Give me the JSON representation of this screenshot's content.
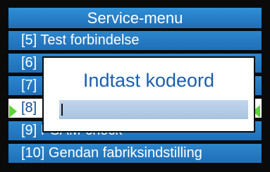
{
  "header": {
    "title": "Service-menu"
  },
  "menu": {
    "items": [
      {
        "label": "[5] Test forbindelse"
      },
      {
        "label": "[6]"
      },
      {
        "label": "[7]"
      },
      {
        "label": "[8]"
      },
      {
        "label": "[9] PSAM-check"
      },
      {
        "label": "[10] Gendan fabriksindstilling"
      }
    ],
    "selected_index": 3
  },
  "dialog": {
    "title": "Indtast kodeord",
    "input_value": ""
  },
  "icons": {
    "left_indicator": "triangle-right-icon",
    "right_indicator": "triangle-left-icon"
  },
  "colors": {
    "menu_blue": "#1f6fb8",
    "selected_bg": "#ffffff",
    "selected_text": "#0e4f9e",
    "indicator_green": "#5fd13a",
    "dialog_title": "#1a5fae",
    "input_bg": "#b3cbe6"
  }
}
